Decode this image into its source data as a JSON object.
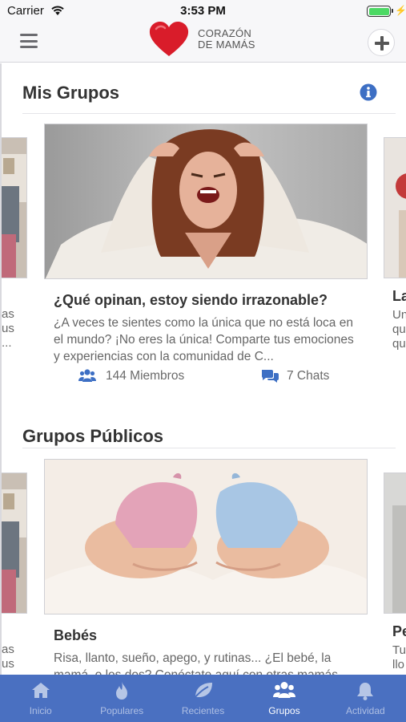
{
  "status_bar": {
    "carrier": "Carrier",
    "time": "3:53 PM"
  },
  "nav": {
    "logo_line1": "CORAZÓN",
    "logo_line2": "DE MAMÁS"
  },
  "sections": {
    "mis_grupos": {
      "title": "Mis Grupos",
      "card": {
        "title": "¿Qué opinan, estoy siendo irrazonable?",
        "description": "¿A veces te sientes como la única que no está loca en el mundo? ¡No eres la única! Comparte tus emociones y experiencias con la comunidad de C...",
        "members": "144 Miembros",
        "chats": "7 Chats"
      },
      "peek_left_lines": [
        "as",
        "us",
        "..."
      ],
      "peek_right_title": "La",
      "peek_right_lines": [
        "Un",
        "qu",
        "qu"
      ]
    },
    "grupos_publicos": {
      "title": "Grupos Públicos",
      "card": {
        "title": "Bebés",
        "description": "Risa, llanto, sueño, apego, y rutinas... ¿El bebé, la mamá, o los dos? Conéctate aquí con otras mamás"
      },
      "peek_left_lines": [
        "as",
        "us"
      ],
      "peek_right_title": "Pe",
      "peek_right_lines": [
        "Tu",
        "llo"
      ]
    }
  },
  "tabs": [
    {
      "label": "Inicio",
      "icon": "home-icon"
    },
    {
      "label": "Populares",
      "icon": "flame-icon"
    },
    {
      "label": "Recientes",
      "icon": "leaf-icon"
    },
    {
      "label": "Grupos",
      "icon": "users-icon"
    },
    {
      "label": "Actividad",
      "icon": "bell-icon"
    }
  ],
  "active_tab": "Grupos",
  "colors": {
    "accent": "#4a70c1",
    "brand_red": "#d91c2a",
    "info_blue": "#3d6fc4"
  }
}
